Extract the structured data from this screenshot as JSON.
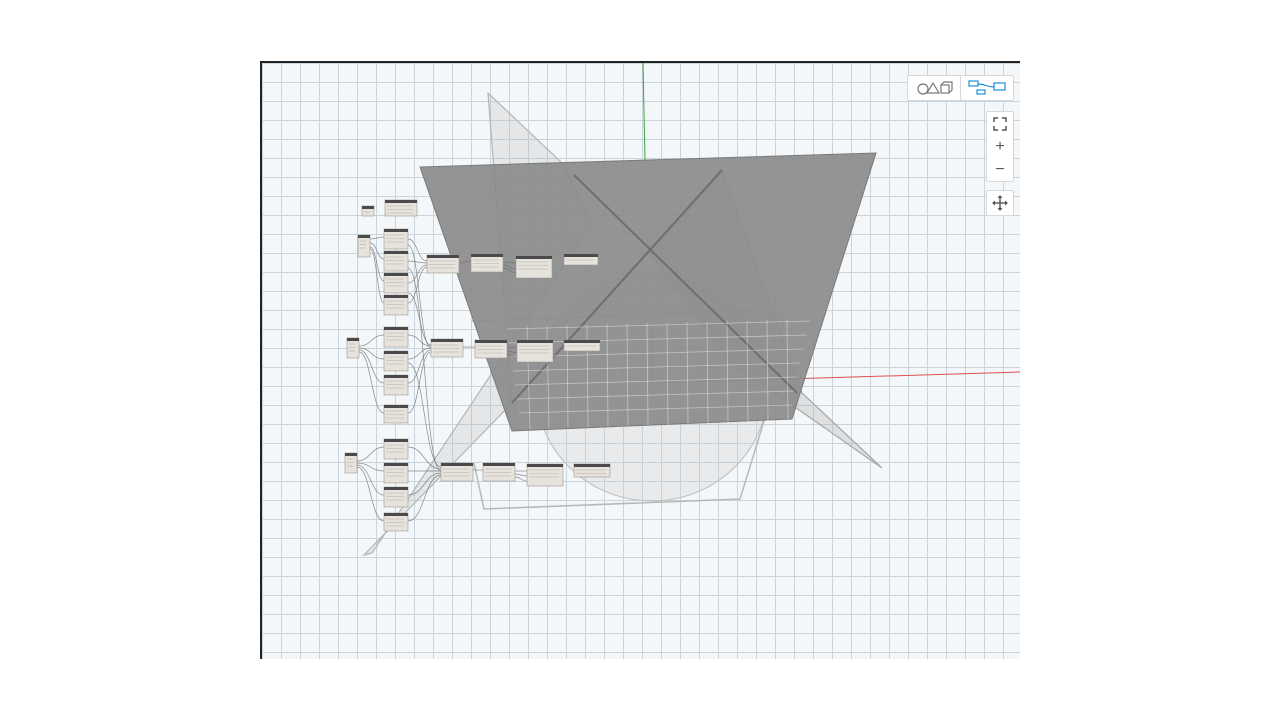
{
  "app": {
    "name": ""
  },
  "viewport": {
    "colors": {
      "background": "#f4f7f9",
      "grid": "#c9d5de",
      "axis_x": "#e05050",
      "axis_y": "#3fa040",
      "surface": "#8c8c8c",
      "node_header": "#4a4a4a",
      "node_body": "#e6e2dc"
    }
  },
  "toolbar": {
    "view_toggle": [
      {
        "icon": "geometry-view-icon",
        "active": false
      },
      {
        "icon": "graph-view-icon",
        "active": true
      }
    ],
    "nav_tools": [
      {
        "icon": "fit-view-icon",
        "glyph": "⛶"
      },
      {
        "icon": "zoom-in-icon",
        "glyph": "+"
      },
      {
        "icon": "zoom-out-icon",
        "glyph": "−"
      }
    ],
    "pan_tool": {
      "icon": "pan-icon"
    }
  },
  "graph": {
    "node_count": 34
  }
}
